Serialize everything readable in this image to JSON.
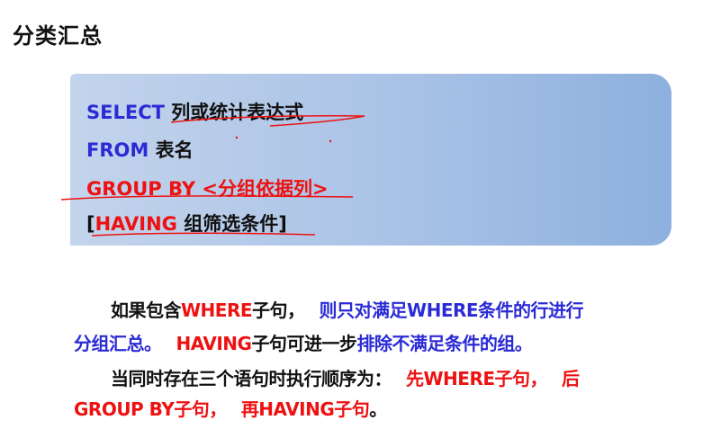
{
  "title": "分类汇总",
  "sql": {
    "select_kw": "SELECT",
    "select_rest": "列或统计表达式",
    "from_kw": "FROM",
    "from_rest": "表名",
    "group_kw": "GROUP BY",
    "group_rest": "<分组依据列>",
    "having_open": "[",
    "having_kw": "HAVING",
    "having_rest": "组筛选条件]"
  },
  "paragraphs": {
    "p1_a": "如果包含",
    "p1_b": "WHERE",
    "p1_c": "子句，",
    "p1_d": "则只对满足WHERE条件的行进行",
    "p2_a": "分组汇总。",
    "p2_b": "HAVING",
    "p2_c": "子句可进一步",
    "p2_d": "排除不满足条件的组。",
    "p3_a": "当同时存在三个语句时执行顺序为：",
    "p3_b": "先WHERE子句，",
    "p3_c": "后",
    "p4_a": "GROUP BY子句，",
    "p4_b": "再HAVING子句",
    "p4_c": "。"
  },
  "colors": {
    "keyword_blue": "#2b2bd6",
    "keyword_red": "#ee1111",
    "box_gradient_start": "#c3d4ec",
    "box_gradient_end": "#8db0de"
  }
}
